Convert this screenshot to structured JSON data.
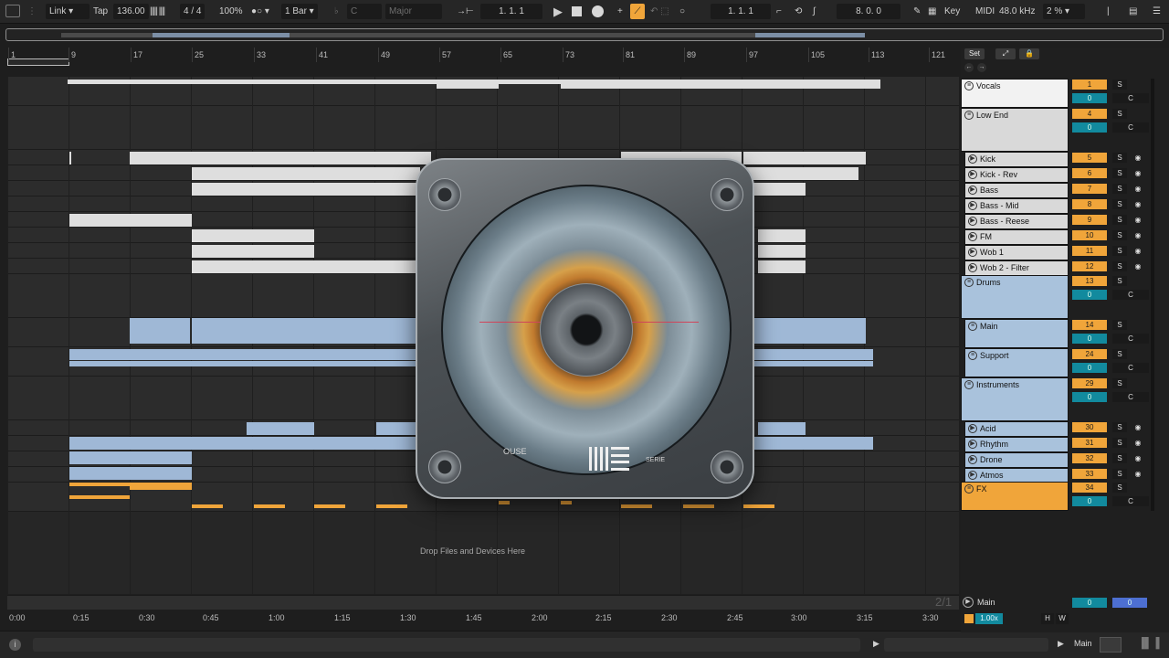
{
  "toolbar": {
    "link": "Link",
    "tap": "Tap",
    "tempo": "136.00",
    "time_signature": "4 / 4",
    "zoom": "100%",
    "quantize": "1 Bar",
    "key": "C",
    "scale": "Major",
    "position": "1.  1.  1",
    "loop_start": "1.  1.  1",
    "loop_length": "8.  0.  0",
    "key_map": "Key",
    "midi_map": "MIDI",
    "sample_rate": "48.0 kHz",
    "cpu": "2 %"
  },
  "ruler": {
    "bars": [
      "1",
      "9",
      "17",
      "25",
      "33",
      "41",
      "49",
      "57",
      "65",
      "73",
      "81",
      "89",
      "97",
      "105",
      "113",
      "121"
    ]
  },
  "timeline": {
    "times": [
      "0:00",
      "0:15",
      "0:30",
      "0:45",
      "1:00",
      "1:15",
      "1:30",
      "1:45",
      "2:00",
      "2:15",
      "2:30",
      "2:45",
      "3:00",
      "3:15",
      "3:30"
    ],
    "page_indicator": "2/1"
  },
  "arrangement": {
    "drop_hint": "Drop Files and Devices Here"
  },
  "mixer": {
    "set_label": "Set",
    "tracks": [
      {
        "name": "Vocals",
        "number": "1",
        "volume": "0"
      },
      {
        "name": "Low End",
        "number": "4",
        "volume": "0"
      },
      {
        "name": "Kick",
        "number": "5"
      },
      {
        "name": "Kick - Rev",
        "number": "6"
      },
      {
        "name": "Bass",
        "number": "7"
      },
      {
        "name": "Bass - Mid",
        "number": "8"
      },
      {
        "name": "Bass - Reese",
        "number": "9"
      },
      {
        "name": "FM",
        "number": "10"
      },
      {
        "name": "Wob 1",
        "number": "11"
      },
      {
        "name": "Wob 2 - Filter",
        "number": "12"
      },
      {
        "name": "Drums",
        "number": "13",
        "volume": "0"
      },
      {
        "name": "Main",
        "number": "14",
        "volume": "0"
      },
      {
        "name": "Support",
        "number": "24",
        "volume": "0"
      },
      {
        "name": "Instruments",
        "number": "29",
        "volume": "0"
      },
      {
        "name": "Acid",
        "number": "30"
      },
      {
        "name": "Rhythm",
        "number": "31"
      },
      {
        "name": "Drone",
        "number": "32"
      },
      {
        "name": "Atmos",
        "number": "33"
      },
      {
        "name": "FX",
        "number": "34",
        "volume": "0"
      }
    ],
    "solo_label": "S",
    "center_label": "C",
    "main_track": {
      "name": "Main",
      "vol_left": "0",
      "vol_right": "0"
    },
    "h_label": "H",
    "w_label": "W",
    "tempo_follow": "1.00x"
  },
  "status": {
    "output": "Main"
  },
  "artwork": {
    "logo_text": "OUSE",
    "logo_text_right": "SERIE"
  },
  "colors": {
    "accent_orange": "#f0a53a",
    "volume_teal": "#128a9e",
    "clip_white": "#dedede",
    "clip_blue": "#9fb8d6",
    "group_blue": "#a9c2dc",
    "group_orange": "#f0a53a"
  }
}
